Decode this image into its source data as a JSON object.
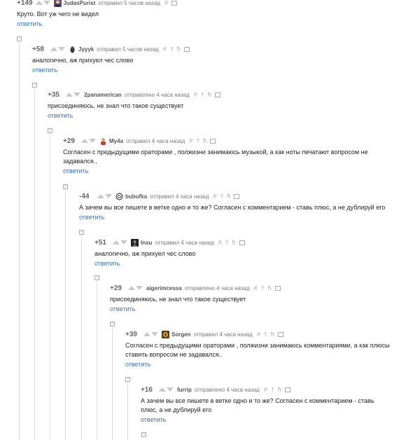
{
  "reply_label": "ответить",
  "tools": [
    "#",
    "†",
    "ħ"
  ],
  "comments": [
    {
      "rating": "+149",
      "username": "JudasPurist",
      "timestamp": "отправил 5 часов назад",
      "text": "Круто. Вот уж чего не видел",
      "avatar": "avatar-warrior"
    },
    {
      "rating": "+58",
      "username": "Jyyyk",
      "timestamp": "отправил 5 часов назад",
      "text": "аналогично, аж прихуел чес слово",
      "avatar": "avatar-bird"
    },
    {
      "rating": "+35",
      "username": "2panamerican",
      "timestamp": "отправлено 4 часа назад",
      "text": "присоединяюсь, не знал что такое существует",
      "avatar": ""
    },
    {
      "rating": "+29",
      "username": "My4a",
      "timestamp": "отправил 4 часа назад",
      "text": "Согласен с предыдущими ораторами , полжизни занимаюсь музыкой, а как ноты печатают вопросом не\nзадавался..",
      "avatar": "avatar-person"
    },
    {
      "rating": "-44",
      "username": "bubufka",
      "timestamp": "отправил 4 часа назад",
      "text": "А зачем вы все пишете в ветке одно и то же? Согласен с комментарием - ставь плюс, а не дублируй его",
      "avatar": "avatar-swirl"
    },
    {
      "rating": "+51",
      "username": "Inxu",
      "timestamp": "отправил 4 часа назад",
      "text": "аналогично, аж прихуел чес слово",
      "avatar": "avatar-dark"
    },
    {
      "rating": "+29",
      "username": "aigerimcessa",
      "timestamp": "отправлено 4 часа назад",
      "text": "присоединяюсь, не знал что такое существует",
      "avatar": ""
    },
    {
      "rating": "+39",
      "username": "Sorgen",
      "timestamp": "отправил 4 часа назад",
      "text": "Согласен с предыдущими ораторами , полжизни занимаюсь комментариями, а как плюсы\nставить вопросом не задавался..",
      "avatar": "avatar-gold"
    },
    {
      "rating": "+16",
      "username": "furrip",
      "timestamp": "отправлено 4 часа назад",
      "text": "А зачем вы все пишете в ветке одно и то же? Согласен с комментарием - ставь\nплюс, а не дублируй его",
      "avatar": ""
    }
  ]
}
